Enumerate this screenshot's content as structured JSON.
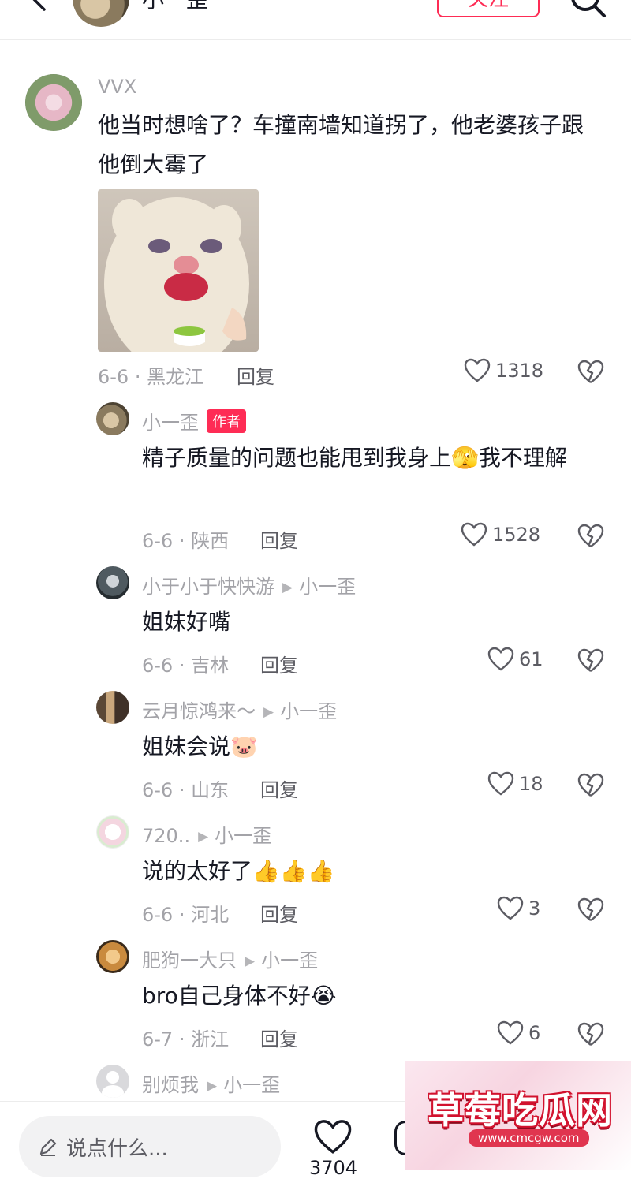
{
  "top_bar": {
    "name": "小一歪",
    "follow_label": "关注"
  },
  "comments": [
    {
      "username": "VVX",
      "text": "他当时想啥了？车撞南墙知道拐了，他老婆孩子跟他倒大霉了",
      "has_sticker": true,
      "date_location": "6-6 · 黑龙江",
      "reply_label": "回复",
      "likes": "1318"
    },
    {
      "username": "小一歪",
      "badge": "作者",
      "text": "精子质量的问题也能甩到我身上🫣我不理解",
      "date_location": "6-6 · 陕西",
      "reply_label": "回复",
      "likes": "1528"
    },
    {
      "username": "小于小于快快游",
      "reply_to": "小一歪",
      "text": "姐妹好嘴",
      "date_location": "6-6 · 吉林",
      "reply_label": "回复",
      "likes": "61"
    },
    {
      "username": "云月惊鸿来～",
      "reply_to": "小一歪",
      "text": "姐妹会说🐷",
      "date_location": "6-6 · 山东",
      "reply_label": "回复",
      "likes": "18"
    },
    {
      "username": "720..",
      "reply_to": "小一歪",
      "text": "说的太好了👍👍👍",
      "date_location": "6-6 · 河北",
      "reply_label": "回复",
      "likes": "3"
    },
    {
      "username": "肥狗一大只",
      "reply_to": "小一歪",
      "text": "bro自己身体不好😭",
      "date_location": "6-7 · 浙江",
      "reply_label": "回复",
      "likes": "6"
    },
    {
      "username": "别烦我",
      "reply_to": "小一歪"
    }
  ],
  "bottom_bar": {
    "input_placeholder": "说点什么...",
    "like_count": "3704"
  },
  "watermark": {
    "title": "草莓吃瓜网",
    "url": "www.cmcgw.com"
  },
  "colors": {
    "accent": "#fe2c55",
    "secondary_text": "#a3a3a8",
    "primary_text": "#161823"
  }
}
